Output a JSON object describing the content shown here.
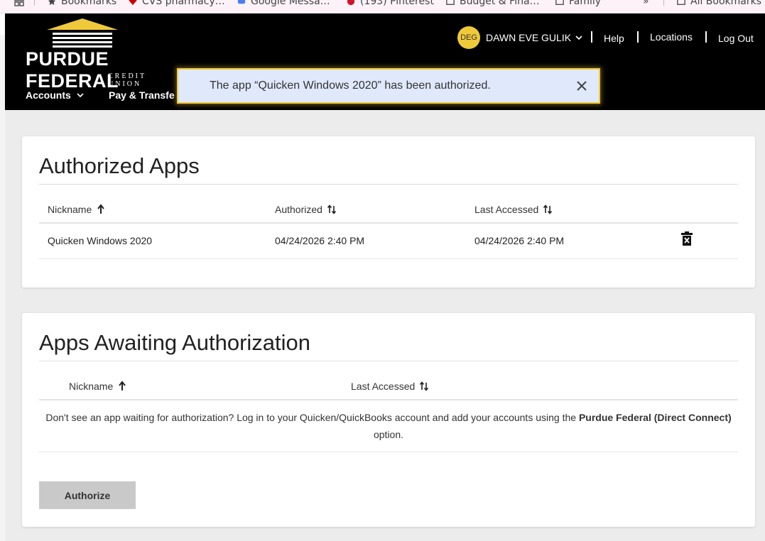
{
  "bookmarks": {
    "items": [
      {
        "label": "Bookmarks",
        "icon": "star-icon"
      },
      {
        "label": "CVS pharmacy…",
        "icon": "cvs-heart-icon"
      },
      {
        "label": "Google Messa…",
        "icon": "google-messages-icon"
      },
      {
        "label": "(193) Pinterest",
        "icon": "pinterest-icon"
      },
      {
        "label": "Budget & Fina…",
        "icon": "folder-icon"
      },
      {
        "label": "Family",
        "icon": "folder-icon"
      }
    ],
    "overflow_label": "»",
    "all_bookmarks_label": "All Bookmarks"
  },
  "header": {
    "logo_word": "PURDUE FEDERAL",
    "logo_sub": "CREDIT UNION",
    "user_initials": "DEG",
    "user_name": "DAWN EVE GULIK",
    "links": [
      "Help",
      "Locations",
      "Log Out"
    ],
    "nav": [
      {
        "label": "Accounts"
      },
      {
        "label": "Pay & Transfe"
      }
    ]
  },
  "toast": {
    "message": "The app “Quicken Windows 2020” has been authorized."
  },
  "authorized": {
    "title": "Authorized Apps",
    "columns": [
      "Nickname",
      "Authorized",
      "Last Accessed"
    ],
    "rows": [
      {
        "nickname": "Quicken Windows 2020",
        "authorized": "04/24/2026 2:40 PM",
        "last_accessed": "04/24/2026 2:40 PM"
      }
    ]
  },
  "awaiting": {
    "title": "Apps Awaiting Authorization",
    "columns": [
      "Nickname",
      "Last Accessed"
    ],
    "empty_msg_pre": "Don't see an app waiting for authorization? Log in to your Quicken/QuickBooks account and add your accounts using the ",
    "empty_msg_bold": "Purdue Federal (Direct Connect)",
    "empty_msg_post": " option.",
    "authorize_label": "Authorize"
  },
  "colors": {
    "accent_gold": "#f0c93a",
    "header_bg": "#000000",
    "toast_bg": "#dfe9fb"
  }
}
